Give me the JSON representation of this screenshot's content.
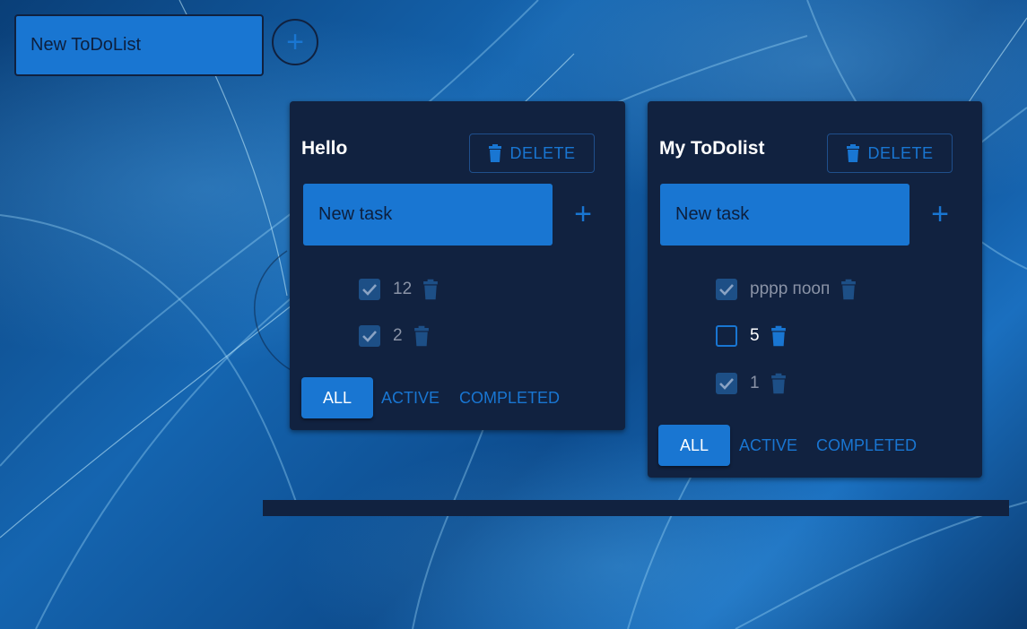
{
  "header": {
    "new_list_placeholder": "New ToDoList",
    "add_icon": "plus-icon"
  },
  "colors": {
    "accent": "#1976d2",
    "card_bg": "#112240",
    "checked_box": "#1d4f86",
    "done_text": "#8a93a6"
  },
  "lists": [
    {
      "title": "Hello",
      "delete_label": "DELETE",
      "new_task_placeholder": "New task",
      "tasks": [
        {
          "text": "12",
          "done": true
        },
        {
          "text": "2",
          "done": true
        }
      ],
      "filters": {
        "all": "ALL",
        "active": "ACTIVE",
        "completed": "COMPLETED"
      },
      "active_filter": "all"
    },
    {
      "title": "My ToDolist",
      "delete_label": "DELETE",
      "new_task_placeholder": "New task",
      "tasks": [
        {
          "text": "рррр пооп",
          "done": true
        },
        {
          "text": "5",
          "done": false
        },
        {
          "text": "1",
          "done": true
        }
      ],
      "filters": {
        "all": "ALL",
        "active": "ACTIVE",
        "completed": "COMPLETED"
      },
      "active_filter": "all"
    }
  ]
}
